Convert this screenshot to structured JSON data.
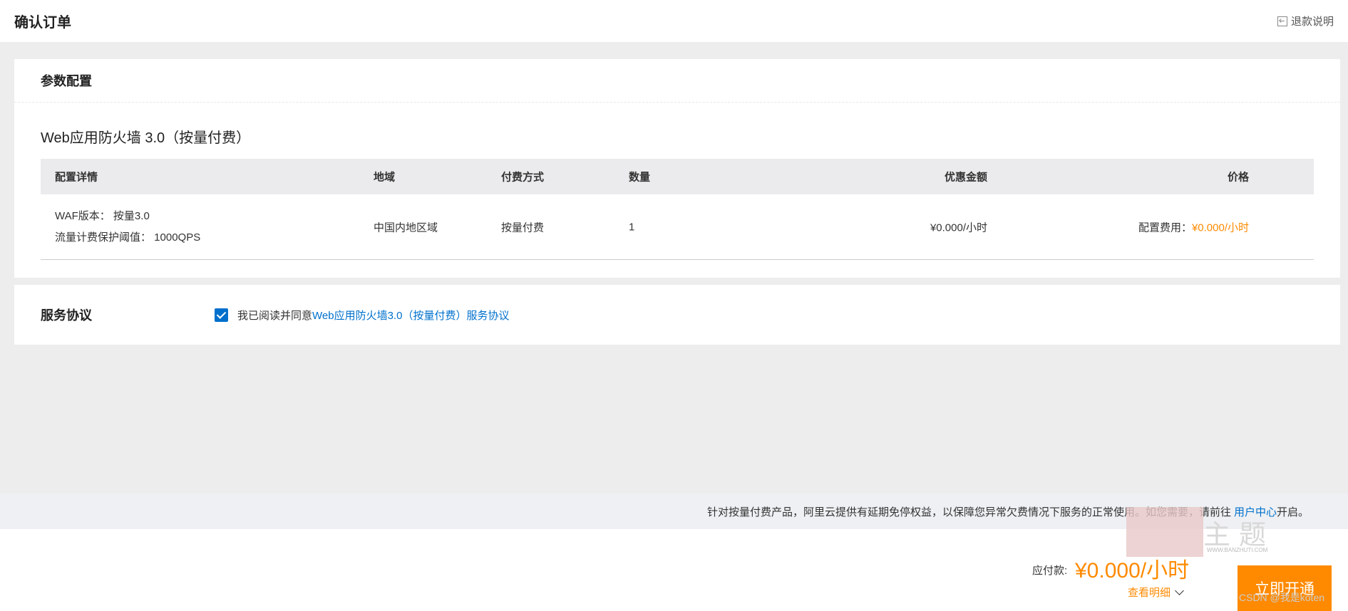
{
  "header": {
    "title": "确认订单",
    "refund_label": "退款说明"
  },
  "params": {
    "title": "参数配置",
    "product_name": "Web应用防火墙 3.0（按量付费）",
    "table": {
      "headers": {
        "detail": "配置详情",
        "region": "地域",
        "pay_type": "付费方式",
        "quantity": "数量",
        "discount": "优惠金额",
        "price": "价格"
      },
      "row": {
        "detail_line1": "WAF版本： 按量3.0",
        "detail_line2": "流量计费保护阈值： 1000QPS",
        "region": "中国内地区域",
        "pay_type": "按量付费",
        "quantity": "1",
        "discount": "¥0.000/小时",
        "price_label": "配置费用：",
        "price_value": "¥0.000/小时"
      }
    }
  },
  "agreement": {
    "title": "服务协议",
    "checked": true,
    "text": "我已阅读并同意",
    "link": "Web应用防火墙3.0（按量付费）服务协议"
  },
  "notice": {
    "text": "针对按量付费产品，阿里云提供有延期免停权益，以保障您异常欠费情况下服务的正常使用。如您需要，请前往",
    "link": "用户中心",
    "suffix": " 开启。"
  },
  "footer": {
    "pay_label": "应付款:",
    "pay_amount": "¥0.000/小时",
    "detail_link": "查看明细",
    "open_button": "立即开通"
  },
  "watermark": {
    "text": "主题",
    "url": "WWW.BANZHUTI.COM",
    "csdn": "CSDN @我是koten"
  },
  "colors": {
    "accent_orange": "#ff8a00",
    "link_blue": "#0070cc"
  }
}
